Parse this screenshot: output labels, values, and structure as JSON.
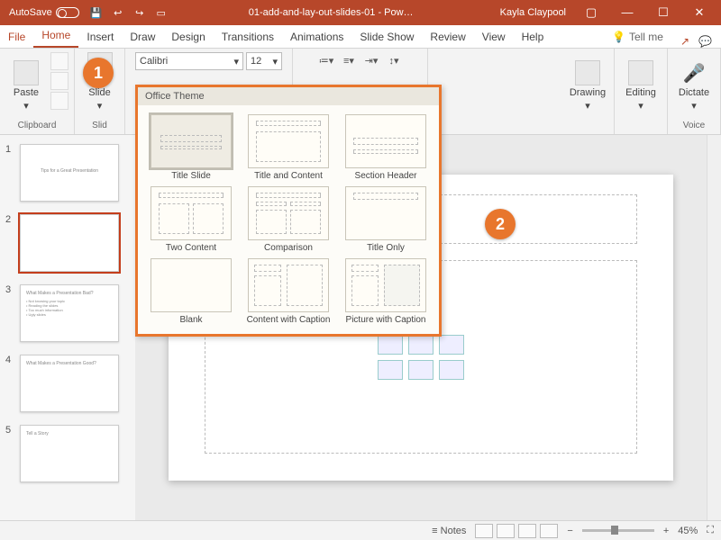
{
  "titlebar": {
    "autosave_label": "AutoSave",
    "doc_title": "01-add-and-lay-out-slides-01 - Pow…",
    "user": "Kayla Claypool"
  },
  "tabs": {
    "file": "File",
    "home": "Home",
    "insert": "Insert",
    "draw": "Draw",
    "design": "Design",
    "transitions": "Transitions",
    "animations": "Animations",
    "slideshow": "Slide Show",
    "review": "Review",
    "view": "View",
    "help": "Help",
    "tellme": "Tell me"
  },
  "ribbon": {
    "clipboard": {
      "label": "Clipboard",
      "paste": "Paste"
    },
    "slides": {
      "label": "Slid",
      "newslide": "New Slide"
    },
    "font": {
      "name": "Calibri",
      "size": "12"
    },
    "drawing": "Drawing",
    "editing": "Editing",
    "voice": {
      "label": "Voice",
      "dictate": "Dictate"
    }
  },
  "gallery": {
    "header": "Office Theme",
    "items": [
      "Title Slide",
      "Title and Content",
      "Section Header",
      "Two Content",
      "Comparison",
      "Title Only",
      "Blank",
      "Content with Caption",
      "Picture with Caption"
    ]
  },
  "callouts": {
    "one": "1",
    "two": "2"
  },
  "thumbs": {
    "nums": [
      "1",
      "2",
      "3",
      "4",
      "5"
    ],
    "t1_title": "Tips for a Great Presentation",
    "t3_title": "What Makes a Presentation Bad?",
    "t4_title": "What Makes a Presentation Good?",
    "t5_title": "Tell a Story"
  },
  "statusbar": {
    "notes": "Notes",
    "zoom": "45%"
  }
}
